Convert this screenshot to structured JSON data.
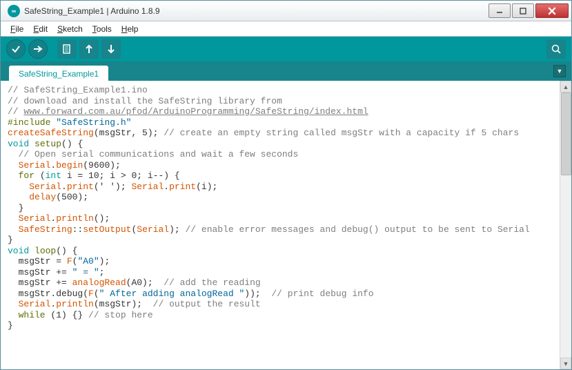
{
  "window": {
    "title": "SafeString_Example1 | Arduino 1.8.9",
    "app_icon_text": "∞"
  },
  "menubar": {
    "file": "File",
    "edit": "Edit",
    "sketch": "Sketch",
    "tools": "Tools",
    "help": "Help"
  },
  "toolbar": {
    "verify": "verify",
    "upload": "upload",
    "new": "new",
    "open": "open",
    "save": "save",
    "monitor": "serial-monitor"
  },
  "tabs": {
    "active": "SafeString_Example1"
  },
  "code_tokens": {
    "l1": "// SafeString_Example1.ino",
    "l2": "// download and install the SafeString library from",
    "l3_prefix": "// ",
    "l3_link": "www.forward.com.au/pfod/ArduinoProgramming/SafeString/index.html",
    "l4_a": "#include",
    "l4_b": "\"SafeString.h\"",
    "l5_a": "createSafeString",
    "l5_b": "(msgStr, 5); ",
    "l5_c": "// create an empty string called msgStr with a capacity if 5 chars",
    "l6_a": "void",
    "l6_b": "setup",
    "l6_c": "() {",
    "l7": "  // Open serial communications and wait a few seconds",
    "l8_a": "  Serial",
    "l8_b": ".",
    "l8_c": "begin",
    "l8_d": "(9600);",
    "l9_a": "  for",
    "l9_b": " (",
    "l9_c": "int",
    "l9_d": " i = 10; i > 0; i--) {",
    "l10_a": "    Serial",
    "l10_b": ".",
    "l10_c": "print",
    "l10_d": "(' '); ",
    "l10_e": "Serial",
    "l10_f": ".",
    "l10_g": "print",
    "l10_h": "(i);",
    "l11_a": "    delay",
    "l11_b": "(500);",
    "l12": "  }",
    "l13_a": "  Serial",
    "l13_b": ".",
    "l13_c": "println",
    "l13_d": "();",
    "l14_a": "  SafeString",
    "l14_b": "::",
    "l14_c": "setOutput",
    "l14_d": "(",
    "l14_e": "Serial",
    "l14_f": "); ",
    "l14_g": "// enable error messages and debug() output to be sent to Serial",
    "l15": "}",
    "l16_a": "void",
    "l16_b": "loop",
    "l16_c": "() {",
    "l17_a": "  msgStr = ",
    "l17_b": "F",
    "l17_c": "(",
    "l17_d": "\"A0\"",
    "l17_e": ");",
    "l18_a": "  msgStr += ",
    "l18_b": "\" = \"",
    "l18_c": ";",
    "l19_a": "  msgStr += ",
    "l19_b": "analogRead",
    "l19_c": "(A0);  ",
    "l19_d": "// add the reading",
    "l20_a": "  msgStr.debug(",
    "l20_b": "F",
    "l20_c": "(",
    "l20_d": "\" After adding analogRead \"",
    "l20_e": "));  ",
    "l20_f": "// print debug info",
    "l21_a": "  Serial",
    "l21_b": ".",
    "l21_c": "println",
    "l21_d": "(msgStr);  ",
    "l21_e": "// output the result",
    "l22_a": "  while",
    "l22_b": " (1) {} ",
    "l22_c": "// stop here",
    "l23": "}"
  }
}
